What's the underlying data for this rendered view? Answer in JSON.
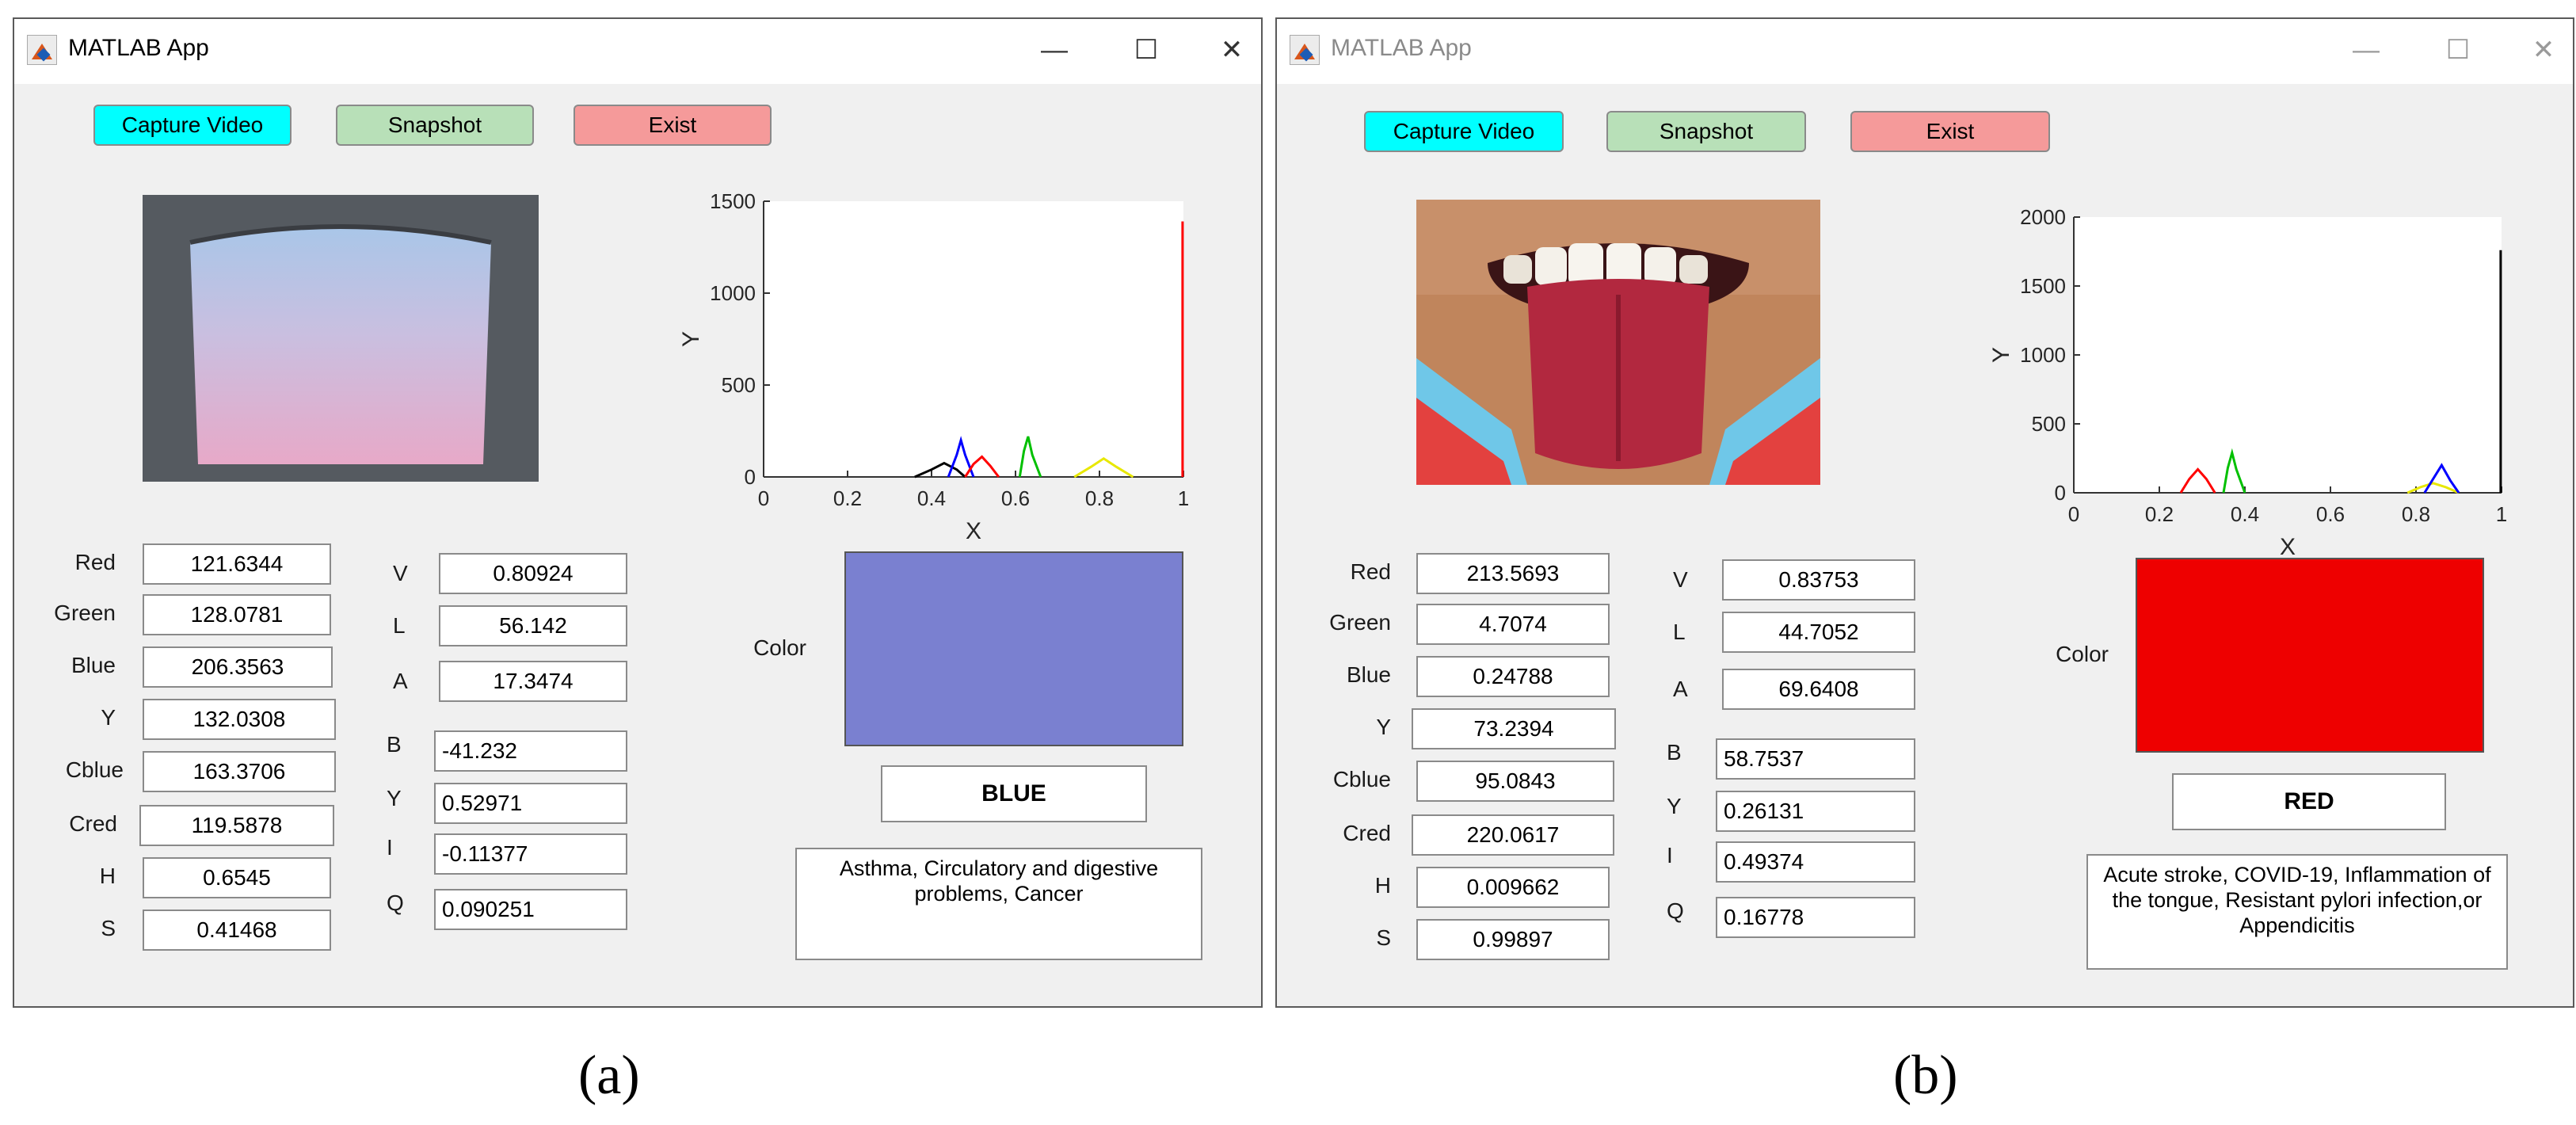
{
  "panels": [
    {
      "window_title": "MATLAB App",
      "buttons": {
        "capture": "Capture Video",
        "snapshot": "Snapshot",
        "exist": "Exist"
      },
      "left_labels": [
        "Red",
        "Green",
        "Blue",
        "Y",
        "Cblue",
        "Cred",
        "H",
        "S"
      ],
      "left_values": [
        "121.6344",
        "128.0781",
        "206.3563",
        "132.0308",
        "163.3706",
        "119.5878",
        "0.6545",
        "0.41468"
      ],
      "right_labels": [
        "V",
        "L",
        "A",
        "B",
        "Y",
        "I",
        "Q"
      ],
      "right_values": [
        "0.80924",
        "56.142",
        "17.3474",
        "-41.232",
        "0.52971",
        "-0.11377",
        "0.090251"
      ],
      "color_label": "Color",
      "swatch_color": "#7a80d0",
      "result": "BLUE",
      "diagnosis": "Asthma, Circulatory and digestive problems, Cancer",
      "caption": "(a)",
      "chart_data": {
        "type": "line",
        "xlabel": "X",
        "ylabel": "Y",
        "xlim": [
          0,
          1
        ],
        "ylim": [
          0,
          1500
        ],
        "xticks": [
          0,
          0.2,
          0.4,
          0.6,
          0.8,
          1
        ],
        "yticks": [
          0,
          500,
          1000,
          1500
        ],
        "series": [
          {
            "color": "#000000",
            "x": [
              0.36,
              0.4,
              0.43,
              0.46,
              0.48
            ],
            "y": [
              0,
              40,
              75,
              40,
              0
            ]
          },
          {
            "color": "#0000ff",
            "x": [
              0.44,
              0.46,
              0.47,
              0.48,
              0.5
            ],
            "y": [
              0,
              120,
              200,
              120,
              0
            ]
          },
          {
            "color": "#ff0000",
            "x": [
              0.48,
              0.5,
              0.52,
              0.54,
              0.56
            ],
            "y": [
              0,
              70,
              110,
              60,
              0
            ]
          },
          {
            "color": "#00c000",
            "x": [
              0.61,
              0.62,
              0.63,
              0.64,
              0.66
            ],
            "y": [
              0,
              140,
              220,
              120,
              0
            ]
          },
          {
            "color": "#e8e800",
            "x": [
              0.74,
              0.78,
              0.81,
              0.84,
              0.88
            ],
            "y": [
              0,
              55,
              100,
              55,
              0
            ]
          },
          {
            "color": "#ff0000",
            "x": [
              0.998,
              0.998
            ],
            "y": [
              0,
              1390
            ]
          }
        ]
      }
    },
    {
      "window_title": "MATLAB App",
      "buttons": {
        "capture": "Capture Video",
        "snapshot": "Snapshot",
        "exist": "Exist"
      },
      "left_labels": [
        "Red",
        "Green",
        "Blue",
        "Y",
        "Cblue",
        "Cred",
        "H",
        "S"
      ],
      "left_values": [
        "213.5693",
        "4.7074",
        "0.24788",
        "73.2394",
        "95.0843",
        "220.0617",
        "0.009662",
        "0.99897"
      ],
      "right_labels": [
        "V",
        "L",
        "A",
        "B",
        "Y",
        "I",
        "Q"
      ],
      "right_values": [
        "0.83753",
        "44.7052",
        "69.6408",
        "58.7537",
        "0.26131",
        "0.49374",
        "0.16778"
      ],
      "color_label": "Color",
      "swatch_color": "#ee0000",
      "result": "RED",
      "diagnosis": "Acute stroke, COVID-19, Inflammation of the tongue, Resistant pylori infection,or Appendicitis",
      "caption": "(b)",
      "chart_data": {
        "type": "line",
        "xlabel": "X",
        "ylabel": "Y",
        "xlim": [
          0,
          1
        ],
        "ylim": [
          0,
          2000
        ],
        "xticks": [
          0,
          0.2,
          0.4,
          0.6,
          0.8,
          1
        ],
        "yticks": [
          0,
          500,
          1000,
          1500,
          2000
        ],
        "series": [
          {
            "color": "#ff0000",
            "x": [
              0.25,
              0.27,
              0.29,
              0.31,
              0.33
            ],
            "y": [
              0,
              100,
              170,
              100,
              0
            ]
          },
          {
            "color": "#00c000",
            "x": [
              0.35,
              0.36,
              0.37,
              0.38,
              0.4
            ],
            "y": [
              0,
              180,
              290,
              170,
              0
            ]
          },
          {
            "color": "#e8e800",
            "x": [
              0.78,
              0.81,
              0.84,
              0.87,
              0.9
            ],
            "y": [
              0,
              40,
              70,
              40,
              0
            ]
          },
          {
            "color": "#0000ff",
            "x": [
              0.82,
              0.84,
              0.86,
              0.88,
              0.9
            ],
            "y": [
              0,
              100,
              200,
              90,
              0
            ]
          },
          {
            "color": "#000000",
            "x": [
              0.998,
              0.998
            ],
            "y": [
              0,
              1760
            ]
          }
        ]
      }
    }
  ]
}
